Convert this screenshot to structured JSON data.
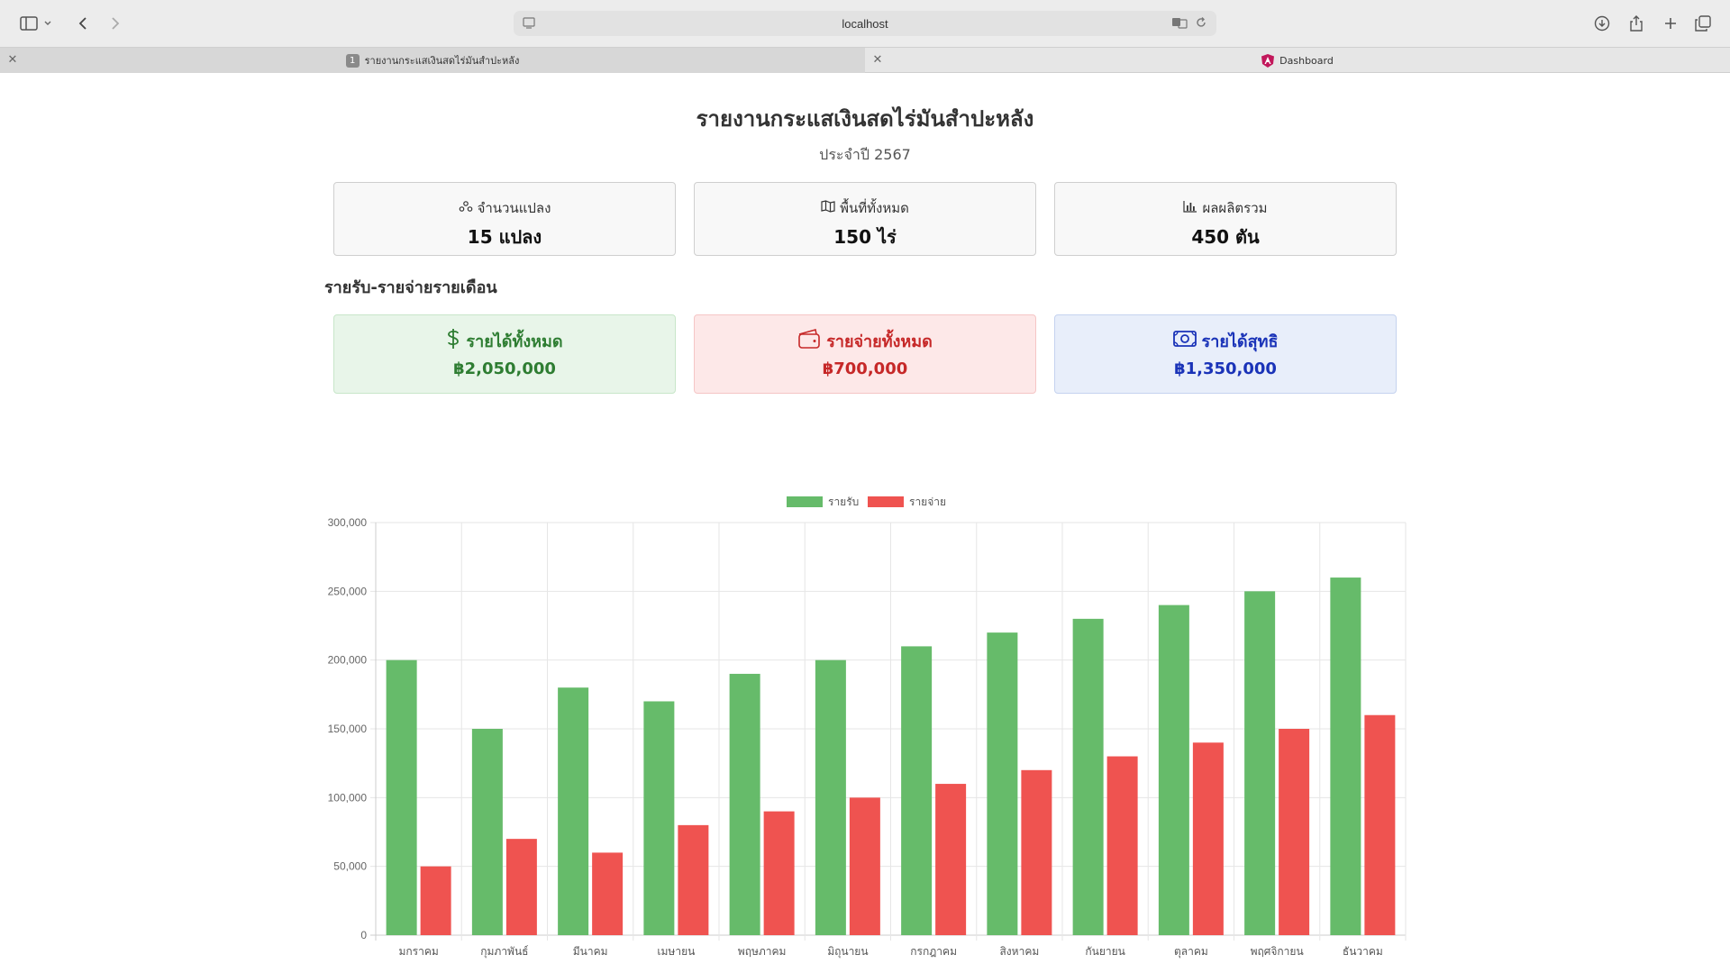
{
  "browser": {
    "address": "localhost",
    "tabs": [
      {
        "number": "1",
        "label": "รายงานกระแสเงินสดไร่มันสำปะหลัง"
      },
      {
        "label": "Dashboard"
      }
    ]
  },
  "header": {
    "title": "รายงานกระแสเงินสดไร่มันสำปะหลัง",
    "subtitle": "ประจำปี 2567"
  },
  "stats": [
    {
      "icon": "plots-icon",
      "label": "จำนวนแปลง",
      "value": "15 แปลง"
    },
    {
      "icon": "map-icon",
      "label": "พื้นที่ทั้งหมด",
      "value": "150 ไร่"
    },
    {
      "icon": "bar-chart-icon",
      "label": "ผลผลิตรวม",
      "value": "450 ตัน"
    }
  ],
  "section_title": "รายรับ-รายจ่ายรายเดือน",
  "summary": {
    "income": {
      "icon": "dollar-icon",
      "label": "รายได้ทั้งหมด",
      "value": "฿2,050,000",
      "color": "#2e7d32"
    },
    "expense": {
      "icon": "wallet-icon",
      "label": "รายจ่ายทั้งหมด",
      "value": "฿700,000",
      "color": "#c62828"
    },
    "net": {
      "icon": "cash-icon",
      "label": "รายได้สุทธิ",
      "value": "฿1,350,000",
      "color": "#1a33b8"
    }
  },
  "chart_data": {
    "type": "bar",
    "categories": [
      "มกราคม",
      "กุมภาพันธ์",
      "มีนาคม",
      "เมษายน",
      "พฤษภาคม",
      "มิถุนายน",
      "กรกฎาคม",
      "สิงหาคม",
      "กันยายน",
      "ตุลาคม",
      "พฤศจิกายน",
      "ธันวาคม"
    ],
    "series": [
      {
        "name": "รายรับ",
        "color": "#66bb6a",
        "values": [
          200000,
          150000,
          180000,
          170000,
          190000,
          200000,
          210000,
          220000,
          230000,
          240000,
          250000,
          260000
        ]
      },
      {
        "name": "รายจ่าย",
        "color": "#ef5350",
        "values": [
          50000,
          70000,
          60000,
          80000,
          90000,
          100000,
          110000,
          120000,
          130000,
          140000,
          150000,
          160000
        ]
      }
    ],
    "ylim": [
      0,
      300000
    ],
    "yticks": [
      "0",
      "50,000",
      "100,000",
      "150,000",
      "200,000",
      "250,000",
      "300,000"
    ],
    "legend": "top",
    "grid": true
  }
}
